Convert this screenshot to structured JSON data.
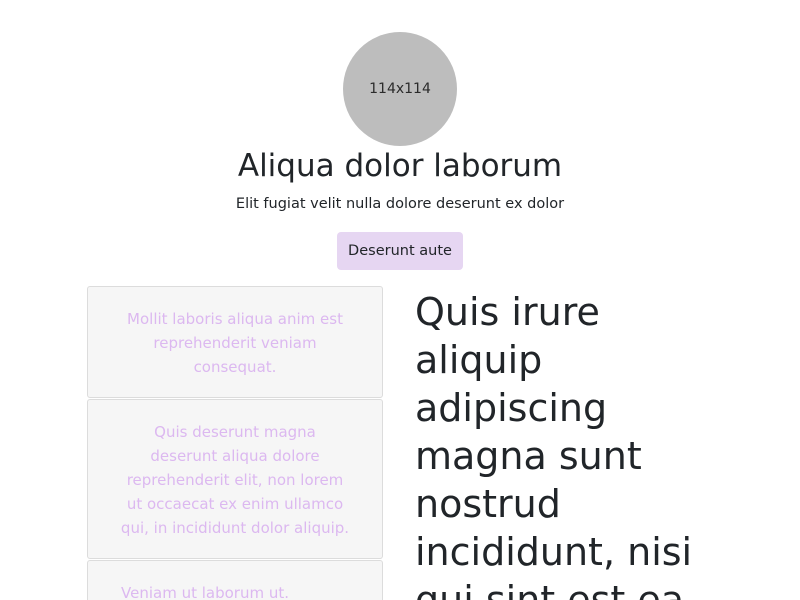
{
  "header": {
    "avatar_label": "114x114",
    "title": "Aliqua dolor laborum",
    "subtitle": "Elit fugiat velit nulla dolore deserunt ex dolor",
    "button_label": "Deserunt aute"
  },
  "cards": [
    {
      "text": "Mollit laboris aliqua anim est reprehenderit veniam consequat."
    },
    {
      "text": "Quis deserunt magna deserunt aliqua dolore reprehenderit elit, non lorem ut occaecat ex enim ullamco qui, in incididunt dolor aliquip."
    },
    {
      "text": "Veniam ut laborum ut."
    }
  ],
  "main": {
    "heading": "Quis irure aliquip adipiscing magna sunt nostrud incididunt, nisi qui sint est ea"
  },
  "colors": {
    "accent_button_bg": "#e6d6f2",
    "card_text": "#dcb8f0",
    "avatar_bg": "#bdbdbd"
  }
}
